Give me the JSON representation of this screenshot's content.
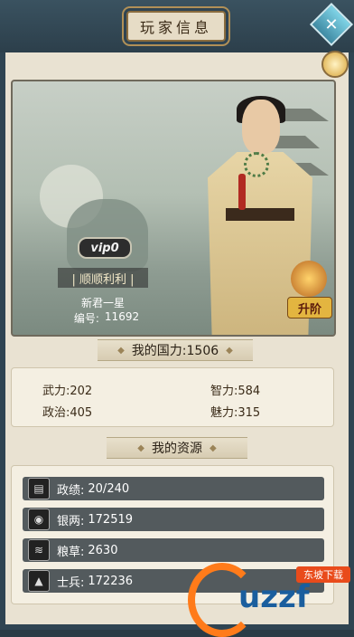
{
  "window": {
    "title": "玩家信息",
    "close_label": "✕"
  },
  "player": {
    "vip": "vip0",
    "name": "| 顺顺利利 |",
    "rank": "新君一星",
    "id_label": "编号:",
    "id_value": "11692",
    "upgrade_label": "升阶"
  },
  "power": {
    "label": "我的国力:1506"
  },
  "stats": {
    "wuli": "武力:202",
    "zhili": "智力:584",
    "zhengzhi": "政治:405",
    "meili": "魅力:315"
  },
  "resources": {
    "section_title": "我的资源",
    "items": [
      {
        "icon": "book-icon",
        "label": "政绩:",
        "value": "20/240"
      },
      {
        "icon": "coin-icon",
        "label": "银两:",
        "value": "172519"
      },
      {
        "icon": "grain-icon",
        "label": "粮草:",
        "value": "2630"
      },
      {
        "icon": "soldier-icon",
        "label": "士兵:",
        "value": "172236"
      }
    ]
  },
  "watermark": {
    "text": "uzzf",
    "sub": "东坡下载"
  }
}
